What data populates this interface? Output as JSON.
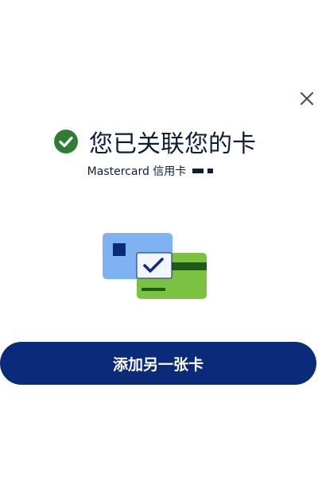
{
  "dialog": {
    "title": "您已关联您的卡",
    "subtitle": "Mastercard 信用卡",
    "primary_button_label": "添加另一张卡"
  },
  "icons": {
    "close": "close-icon",
    "success": "check-circle-icon",
    "illustration": "linked-cards-illustration"
  },
  "colors": {
    "success_green": "#2e7d32",
    "primary_navy": "#0b2a7a",
    "text_dark": "#0b1f3a",
    "card_blue": "#7fb2f0",
    "card_green": "#7cc242"
  }
}
